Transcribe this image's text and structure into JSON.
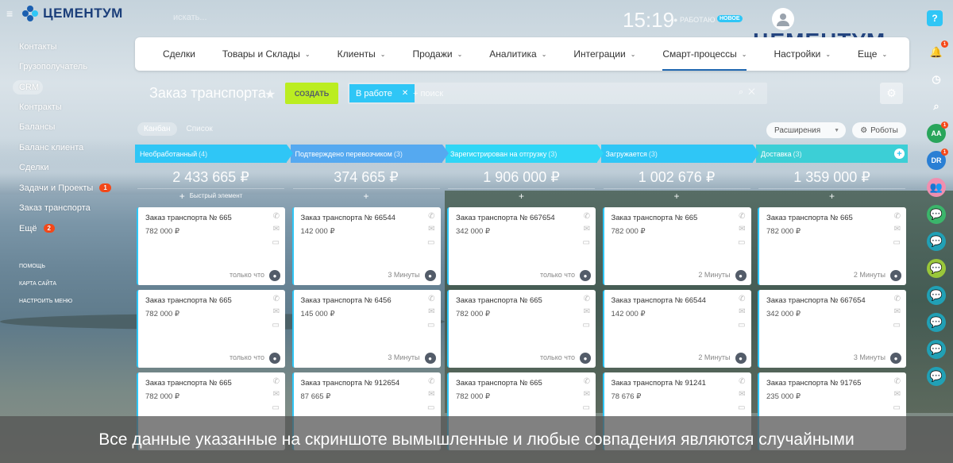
{
  "brand": {
    "name": "ЦЕМЕНТУМ"
  },
  "topbar": {
    "search_placeholder": "искать...",
    "clock": "15:19",
    "work_status": "РАБОТАЮ",
    "new_badge": "НОВОЕ",
    "help": "?"
  },
  "menu": [
    {
      "label": "Сделки",
      "chev": ""
    },
    {
      "label": "Товары и Склады",
      "chev": "⌄"
    },
    {
      "label": "Клиенты",
      "chev": "⌄"
    },
    {
      "label": "Продажи",
      "chev": "⌄"
    },
    {
      "label": "Аналитика",
      "chev": "⌄"
    },
    {
      "label": "Интеграции",
      "chev": "⌄"
    },
    {
      "label": "Смарт-процессы",
      "chev": "⌄"
    },
    {
      "label": "Настройки",
      "chev": "⌄"
    },
    {
      "label": "Еще",
      "chev": "⌄"
    }
  ],
  "sidebar": {
    "items": [
      {
        "label": "Контакты"
      },
      {
        "label": "Грузополучатель"
      },
      {
        "label": "CRM"
      },
      {
        "label": "Контракты"
      },
      {
        "label": "Балансы"
      },
      {
        "label": "Баланс клиента"
      },
      {
        "label": "Сделки"
      },
      {
        "label": "Задачи и Проекты",
        "count": "1"
      },
      {
        "label": "Заказ транспорта"
      },
      {
        "label": "Ещё",
        "count": "2"
      }
    ],
    "footer": [
      "ПОМОЩЬ",
      "КАРТА САЙТА",
      "НАСТРОИТЬ МЕНЮ"
    ]
  },
  "page": {
    "title": "Заказ транспорта",
    "create_label": "СОЗДАТЬ",
    "filter_chip": "В работе",
    "filter_placeholder": "+ поиск",
    "view_kanban": "Канбан",
    "view_list": "Список",
    "extensions": "Расширения",
    "robots": "Роботы",
    "quick_add": "Быстрый элемент"
  },
  "columns": [
    {
      "name": "Необработанный",
      "count": "(4)",
      "color": "#2fc6f6",
      "sum": "2 433 665 ₽",
      "cards": [
        {
          "title": "Заказ транспорта № 665",
          "price": "782 000 ₽",
          "time": "только что"
        },
        {
          "title": "Заказ транспорта № 665",
          "price": "782 000 ₽",
          "time": "только что"
        },
        {
          "title": "Заказ транспорта № 665",
          "price": "782 000 ₽",
          "time": ""
        }
      ]
    },
    {
      "name": "Подтверждено перевозчиком",
      "count": "(3)",
      "color": "#55a9f0",
      "sum": "374 665 ₽",
      "cards": [
        {
          "title": "Заказ транспорта № 66544",
          "price": "142 000 ₽",
          "time": "3 Минуты"
        },
        {
          "title": "Заказ транспорта № 6456",
          "price": "145 000 ₽",
          "time": "3 Минуты"
        },
        {
          "title": "Заказ транспорта № 912654",
          "price": "87 665 ₽",
          "time": ""
        }
      ]
    },
    {
      "name": "Зарегистрирован на отгрузку",
      "count": "(3)",
      "color": "#2fd6f6",
      "sum": "1 906 000 ₽",
      "cards": [
        {
          "title": "Заказ транспорта № 667654",
          "price": "342 000 ₽",
          "time": "только что"
        },
        {
          "title": "Заказ транспорта № 665",
          "price": "782 000 ₽",
          "time": "только что"
        },
        {
          "title": "Заказ транспорта № 665",
          "price": "782 000 ₽",
          "time": ""
        }
      ]
    },
    {
      "name": "Загружается",
      "count": "(3)",
      "color": "#2fc6f6",
      "sum": "1 002 676 ₽",
      "cards": [
        {
          "title": "Заказ транспорта № 665",
          "price": "782 000 ₽",
          "time": "2 Минуты"
        },
        {
          "title": "Заказ транспорта № 66544",
          "price": "142 000 ₽",
          "time": "2 Минуты"
        },
        {
          "title": "Заказ транспорта № 91241",
          "price": "78 676 ₽",
          "time": ""
        }
      ]
    },
    {
      "name": "Доставка",
      "count": "(3)",
      "color": "#3ccfd6",
      "sum": "1 359 000 ₽",
      "cards": [
        {
          "title": "Заказ транспорта № 665",
          "price": "782 000 ₽",
          "time": "2 Минуты"
        },
        {
          "title": "Заказ транспорта № 667654",
          "price": "342 000 ₽",
          "time": "3 Минуты"
        },
        {
          "title": "Заказ транспорта № 91765",
          "price": "235 000 ₽",
          "time": ""
        }
      ]
    }
  ],
  "rightbar": [
    {
      "kind": "bell-icon",
      "badge": "1",
      "color": "transparent",
      "text": ""
    },
    {
      "kind": "timer-icon",
      "badge": "",
      "color": "transparent",
      "text": ""
    },
    {
      "kind": "search-icon",
      "badge": "",
      "color": "transparent",
      "text": ""
    },
    {
      "kind": "user-avatar",
      "badge": "1",
      "color": "#29a55b",
      "text": "AA"
    },
    {
      "kind": "user-avatar",
      "badge": "1",
      "color": "#2a7fd4",
      "text": "DR"
    },
    {
      "kind": "group-icon",
      "badge": "",
      "color": "#f08fb0",
      "text": ""
    },
    {
      "kind": "chat-icon",
      "badge": "",
      "color": "#3bb56b",
      "text": ""
    },
    {
      "kind": "chat-icon",
      "badge": "",
      "color": "#21a0b5",
      "text": ""
    },
    {
      "kind": "chat-icon",
      "badge": "",
      "color": "#9ac73a",
      "text": ""
    },
    {
      "kind": "chat-icon",
      "badge": "",
      "color": "#21a0b5",
      "text": ""
    },
    {
      "kind": "chat-icon",
      "badge": "",
      "color": "#21a0b5",
      "text": ""
    },
    {
      "kind": "chat-icon",
      "badge": "",
      "color": "#21a0b5",
      "text": ""
    },
    {
      "kind": "chat-icon",
      "badge": "",
      "color": "#21a0b5",
      "text": ""
    }
  ],
  "disclaimer": "Все данные указанные на скриншоте вымышленные и любые совпадения являются случайными"
}
